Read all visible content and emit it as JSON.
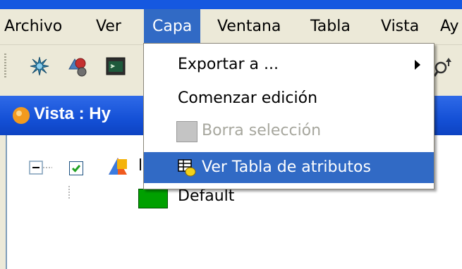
{
  "menubar": {
    "items": [
      "Archivo",
      "Ver",
      "Capa",
      "Ventana",
      "Tabla",
      "Vista",
      "Ay"
    ]
  },
  "toolbar": {
    "icons": [
      "gvsig-icon",
      "add-layer-icon",
      "console-icon"
    ]
  },
  "window": {
    "title": "Vista : Hy"
  },
  "toc": {
    "layer_name": "l",
    "legend_label": "Default",
    "legend_color": "#00a000"
  },
  "capa_menu": {
    "items": [
      {
        "label": "Exportar a ...",
        "submenu": true
      },
      {
        "label": "Comenzar edición"
      },
      {
        "label": "Borra selección",
        "disabled": true
      },
      {
        "label": "Ver Tabla de atributos",
        "highlighted": true
      }
    ]
  },
  "colors": {
    "selection": "#316ac5",
    "title_bar": "#1450d6",
    "disabled_text": "#a7a79e"
  }
}
